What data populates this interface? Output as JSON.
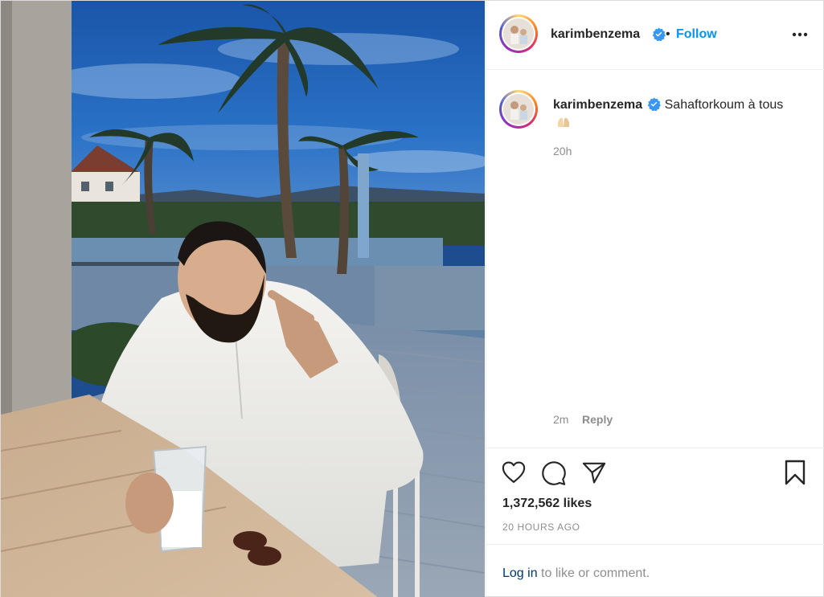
{
  "post": {
    "username": "karimbenzema",
    "follow_label": "Follow",
    "separator": "•",
    "caption_text": "Sahaftorkoum à tous",
    "caption_time": "20h",
    "reply_time": "2m",
    "reply_label": "Reply",
    "likes": "1,372,562 likes",
    "posted_ago": "20 HOURS AGO",
    "login_link": "Log in",
    "login_rest": " to like or comment."
  },
  "icons": {
    "verified": "verified-badge-icon",
    "more": "more-options-icon",
    "like": "heart-icon",
    "comment": "comment-bubble-icon",
    "share": "paper-plane-icon",
    "save": "bookmark-icon",
    "caption_emoji": "folded-hands-emoji"
  },
  "colors": {
    "follow_blue": "#0095f6",
    "verified_blue": "#3897f0",
    "link_dark": "#00376b",
    "muted": "#8e8e8e"
  }
}
